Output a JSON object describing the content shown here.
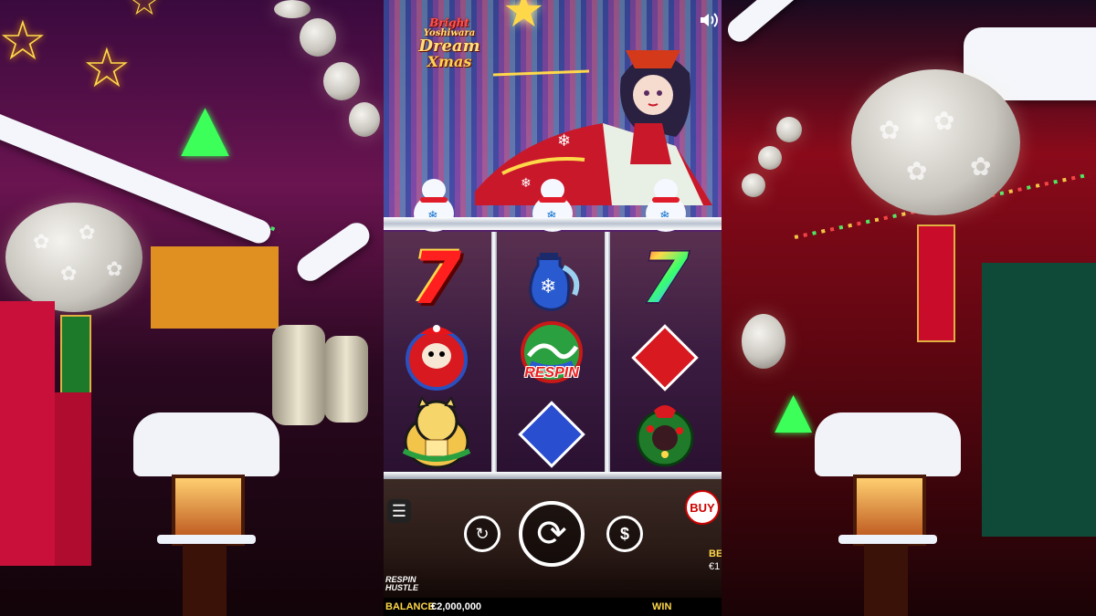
{
  "game": {
    "logo": {
      "line1": "Bright",
      "line2": "Yoshiwara",
      "line3": "Dream",
      "line4": "Xmas"
    },
    "symbols": {
      "respin_text": "RESPIN"
    },
    "controls": {
      "buy_label": "BUY",
      "bet_label": "BET",
      "bet_currency": "€1",
      "respin_logo_line1": "RESPIN",
      "respin_logo_line2": "HUSTLE"
    },
    "footer": {
      "balance_label": "BALANCE",
      "balance_value": "€2,000,000",
      "win_label": "WIN"
    }
  },
  "icons": {
    "sound": "speaker-icon",
    "menu": "hamburger-icon",
    "autoplay": "autoplay-icon",
    "spin": "spin-icon",
    "bet": "dollar-coin-icon"
  },
  "colors": {
    "accent_gold": "#ffd84a",
    "buy_red": "#cc0000",
    "seven_red": "#ff1f1f"
  }
}
